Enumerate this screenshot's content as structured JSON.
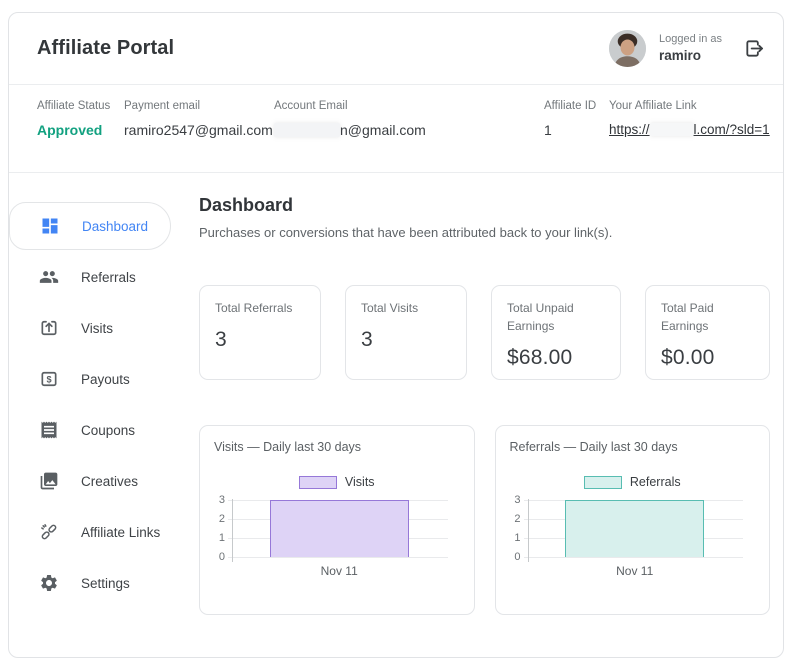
{
  "header": {
    "title": "Affiliate Portal",
    "logged_in_label": "Logged in as",
    "username": "ramiro"
  },
  "info_bar": {
    "status_label": "Affiliate Status",
    "status_value": "Approved",
    "payment_email_label": "Payment email",
    "payment_email_value": "ramiro2547@gmail.com",
    "account_email_label": "Account Email",
    "account_email_redacted": true,
    "account_email_suffix": "n@gmail.com",
    "affiliate_id_label": "Affiliate ID",
    "affiliate_id_value": "1",
    "link_label": "Your Affiliate Link",
    "link_prefix": "https://",
    "link_redacted": true,
    "link_suffix": "l.com/?sld=1"
  },
  "sidebar": {
    "items": [
      {
        "icon": "dashboard-icon",
        "label": "Dashboard",
        "active": true
      },
      {
        "icon": "referrals-icon",
        "label": "Referrals",
        "active": false
      },
      {
        "icon": "visits-icon",
        "label": "Visits",
        "active": false
      },
      {
        "icon": "payouts-icon",
        "label": "Payouts",
        "active": false
      },
      {
        "icon": "coupons-icon",
        "label": "Coupons",
        "active": false
      },
      {
        "icon": "creatives-icon",
        "label": "Creatives",
        "active": false
      },
      {
        "icon": "affiliate-links-icon",
        "label": "Affiliate Links",
        "active": false
      },
      {
        "icon": "settings-icon",
        "label": "Settings",
        "active": false
      }
    ]
  },
  "main": {
    "heading": "Dashboard",
    "description": "Purchases or conversions that have been attributed back to your link(s).",
    "stats": [
      {
        "label": "Total Referrals",
        "value": "3"
      },
      {
        "label": "Total Visits",
        "value": "3"
      },
      {
        "label": "Total Unpaid Earnings",
        "value": "$68.00"
      },
      {
        "label": "Total Paid Earnings",
        "value": "$0.00"
      }
    ]
  },
  "chart_data": [
    {
      "type": "area",
      "title": "Visits — Daily last 30 days",
      "legend": "Visits",
      "categories": [
        "Nov 11"
      ],
      "values": [
        3
      ],
      "ylim": [
        0,
        3
      ],
      "yticks": [
        "3",
        "2",
        "1",
        "0"
      ],
      "grid": true,
      "legend_position": "top-center",
      "line_color": "#9678d8",
      "fill_color": "#ded3f6"
    },
    {
      "type": "area",
      "title": "Referrals — Daily last 30 days",
      "legend": "Referrals",
      "categories": [
        "Nov 11"
      ],
      "values": [
        3
      ],
      "ylim": [
        0,
        3
      ],
      "yticks": [
        "3",
        "2",
        "1",
        "0"
      ],
      "grid": true,
      "legend_position": "top-center",
      "line_color": "#58bdb2",
      "fill_color": "#d8f0ed"
    }
  ],
  "colors": {
    "accent_blue": "#4285f4",
    "status_green": "#12a180",
    "visits_purple": "#9678d8",
    "referrals_teal": "#58bdb2",
    "card_border": "#e1e3e6"
  }
}
